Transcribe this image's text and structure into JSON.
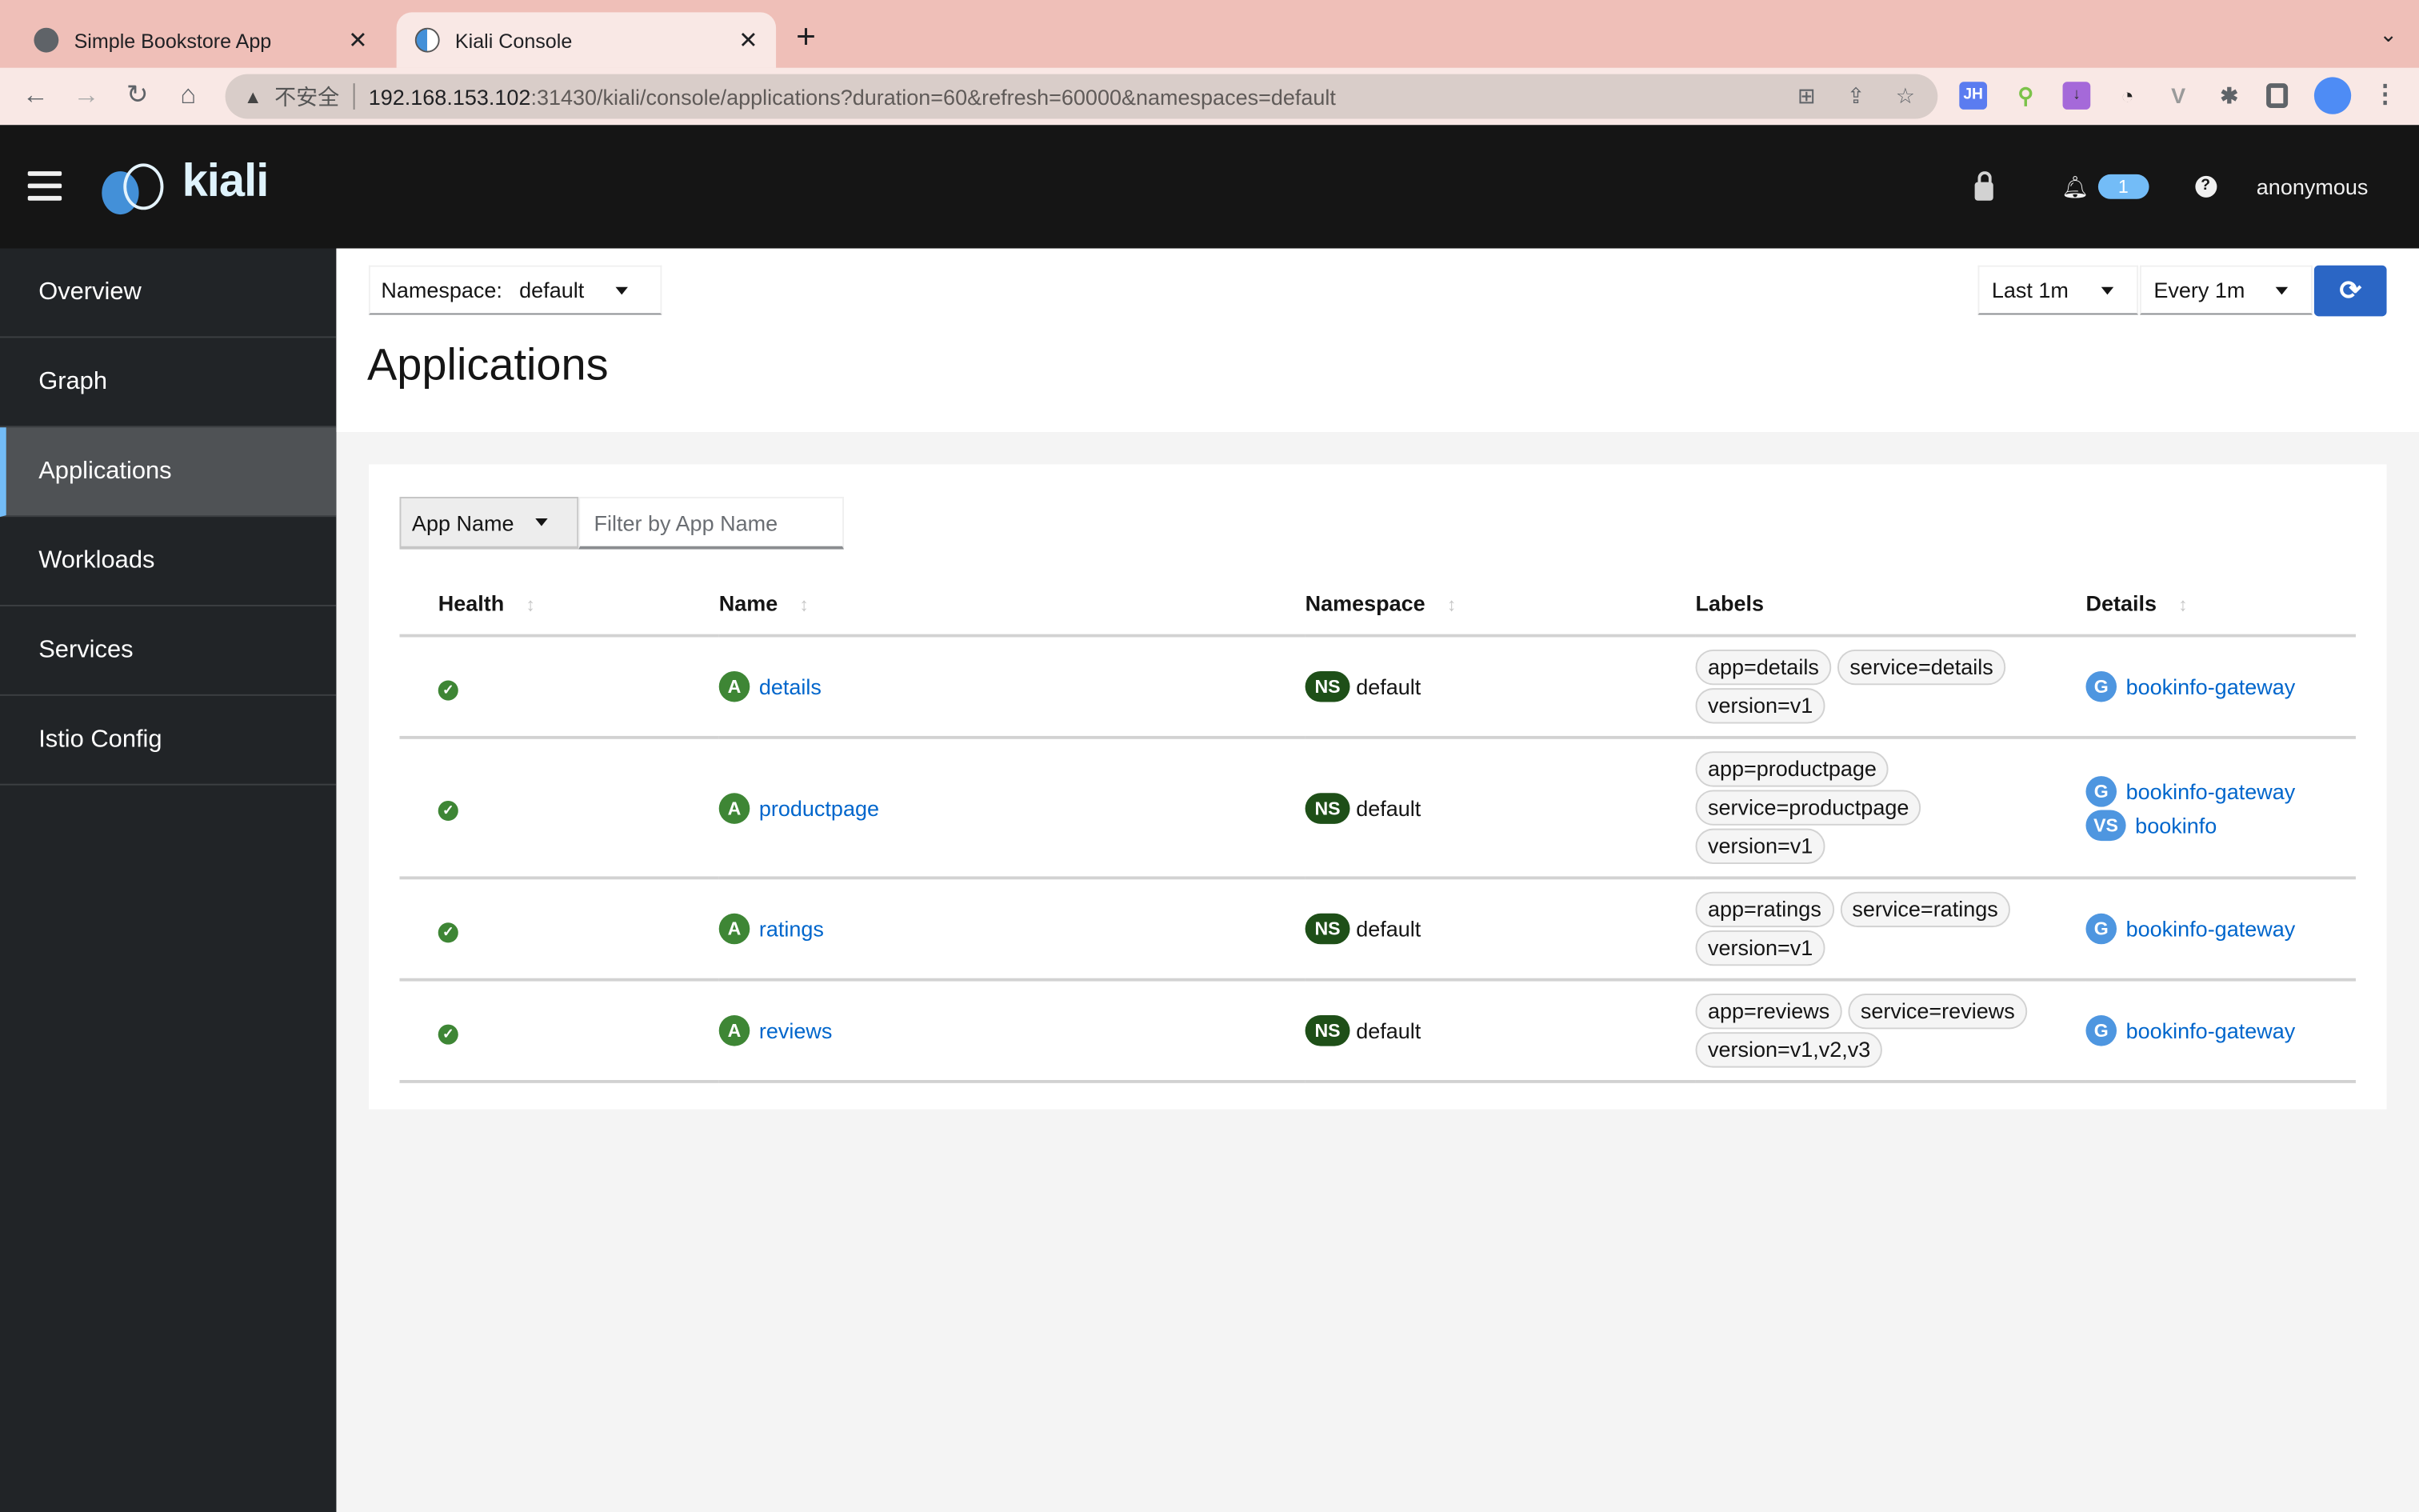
{
  "browser": {
    "tabs": [
      {
        "title": "Simple Bookstore App",
        "active": false
      },
      {
        "title": "Kiali Console",
        "active": true
      }
    ],
    "address": {
      "security_label": "不安全",
      "host": "192.168.153.102",
      "path": ":31430/kiali/console/applications?duration=60&refresh=60000&namespaces=default"
    },
    "extensions": [
      {
        "name": "jh-extension",
        "label": "JH",
        "color": "#5b7cf0"
      },
      {
        "name": "search-extension",
        "label": "",
        "color": "#7cc24a"
      },
      {
        "name": "download-extension",
        "label": "↓",
        "color": "#a569d9"
      },
      {
        "name": "speed-extension",
        "label": "",
        "color": "#222222"
      },
      {
        "name": "vue-extension",
        "label": "V",
        "color": "#9a9a9a"
      }
    ]
  },
  "header": {
    "brand": "kiali",
    "notifications_count": "1",
    "user": "anonymous"
  },
  "sidebar": {
    "items": [
      {
        "label": "Overview",
        "active": false
      },
      {
        "label": "Graph",
        "active": false
      },
      {
        "label": "Applications",
        "active": true
      },
      {
        "label": "Workloads",
        "active": false
      },
      {
        "label": "Services",
        "active": false
      },
      {
        "label": "Istio Config",
        "active": false
      }
    ]
  },
  "toolbar": {
    "namespace_label": "Namespace:",
    "namespace_value": "default",
    "duration": "Last 1m",
    "refresh_interval": "Every 1m"
  },
  "page": {
    "title": "Applications"
  },
  "filter": {
    "type": "App Name",
    "placeholder": "Filter by App Name",
    "value": ""
  },
  "table": {
    "columns": [
      "Health",
      "Name",
      "Namespace",
      "Labels",
      "Details"
    ],
    "rows": [
      {
        "health": "healthy",
        "name": "details",
        "namespace": "default",
        "labels": [
          "app=details",
          "service=details",
          "version=v1"
        ],
        "details": [
          {
            "type": "G",
            "name": "bookinfo-gateway"
          }
        ]
      },
      {
        "health": "healthy",
        "name": "productpage",
        "namespace": "default",
        "labels": [
          "app=productpage",
          "service=productpage",
          "version=v1"
        ],
        "details": [
          {
            "type": "G",
            "name": "bookinfo-gateway"
          },
          {
            "type": "VS",
            "name": "bookinfo"
          }
        ]
      },
      {
        "health": "healthy",
        "name": "ratings",
        "namespace": "default",
        "labels": [
          "app=ratings",
          "service=ratings",
          "version=v1"
        ],
        "details": [
          {
            "type": "G",
            "name": "bookinfo-gateway"
          }
        ]
      },
      {
        "health": "healthy",
        "name": "reviews",
        "namespace": "default",
        "labels": [
          "app=reviews",
          "service=reviews",
          "version=v1,v2,v3"
        ],
        "details": [
          {
            "type": "G",
            "name": "bookinfo-gateway"
          }
        ]
      }
    ]
  },
  "colors": {
    "accent": "#73bcf7",
    "primary_button": "#2b66c5",
    "healthy": "#3e8635",
    "link": "#0066cc"
  }
}
